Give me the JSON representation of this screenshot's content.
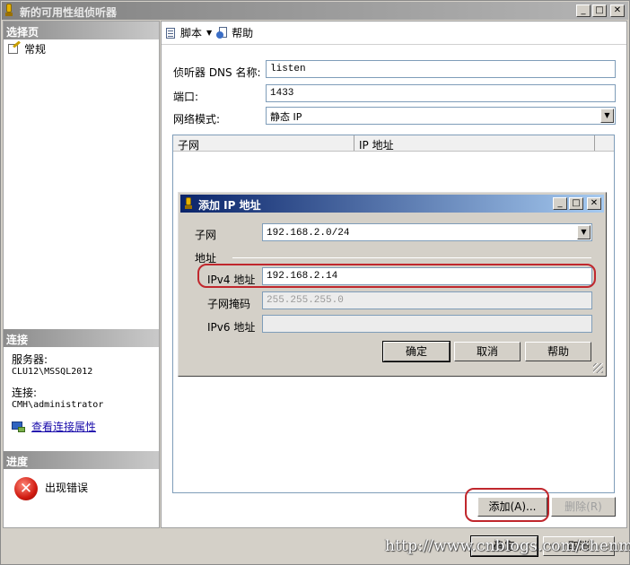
{
  "window": {
    "title": "新的可用性组侦听器",
    "buttons": {
      "minimize": "_",
      "maximize": "□",
      "close": "✕"
    }
  },
  "sidebar": {
    "select_page_header": "选择页",
    "pages": [
      {
        "label": "常规",
        "icon": "general-page-icon"
      }
    ],
    "connection_header": "连接",
    "server_label": "服务器:",
    "server_value": "CLU12\\MSSQL2012",
    "connection_label": "连接:",
    "connection_value": "CMH\\administrator",
    "view_props_link": "查看连接属性",
    "progress_header": "进度",
    "progress_status": "出现错误",
    "progress_icon": "error-icon"
  },
  "toolbar": {
    "script_label": "脚本",
    "help_label": "帮助"
  },
  "form": {
    "dns_label": "侦听器 DNS 名称:",
    "dns_value": "listen",
    "port_label": "端口:",
    "port_value": "1433",
    "network_mode_label": "网络模式:",
    "network_mode_value": "静态 IP"
  },
  "ip_table": {
    "columns": [
      "子网",
      "IP 地址"
    ]
  },
  "buttons": {
    "add": "添加(A)...",
    "remove": "删除(R)",
    "ok": "确定",
    "cancel": "取消"
  },
  "add_ip_dialog": {
    "title": "添加 IP 地址",
    "subnet_label": "子网",
    "subnet_value": "192.168.2.0/24",
    "address_group_label": "地址",
    "ipv4_label": "IPv4 地址",
    "ipv4_value": "192.168.2.14",
    "mask_label": "子网掩码",
    "mask_value": "255.255.255.0",
    "ipv6_label": "IPv6 地址",
    "ipv6_value": "",
    "ok_label": "确定",
    "cancel_label": "取消",
    "help_label": "帮助"
  },
  "watermark": "http://www.cnblogs.com/chenmh",
  "colors": {
    "highlight_ring": "#c0272d",
    "dialog_title_start": "#0a246a",
    "dialog_title_end": "#a6caf0"
  }
}
